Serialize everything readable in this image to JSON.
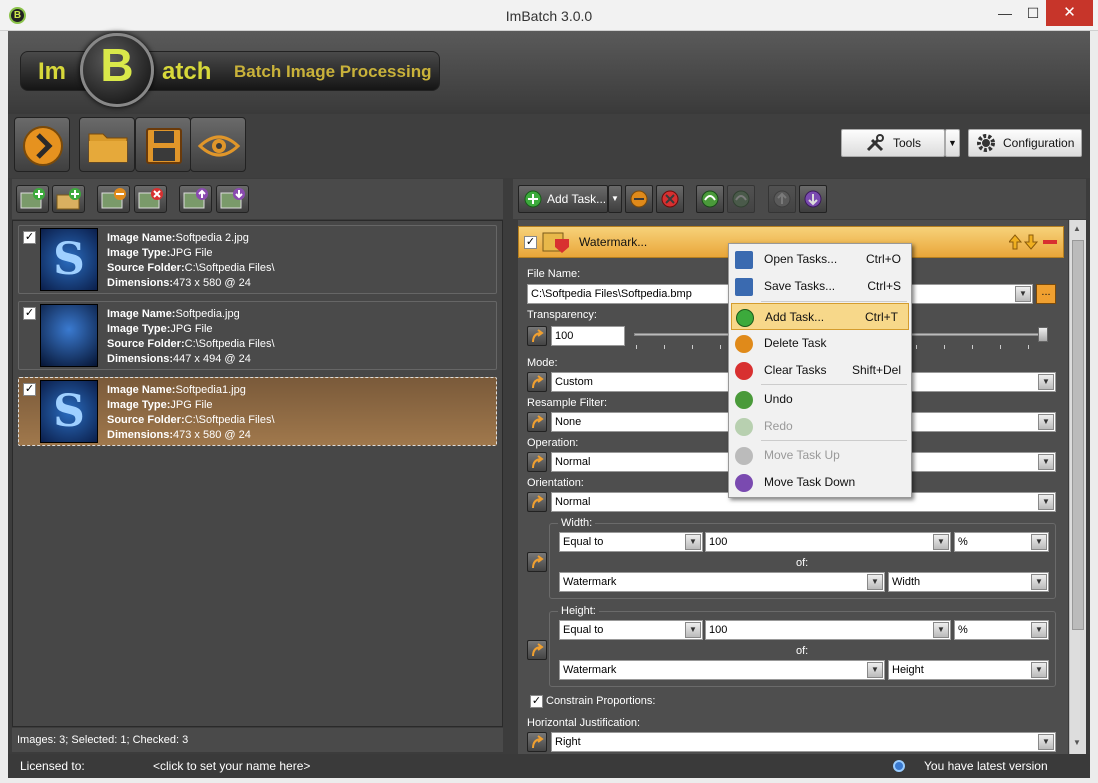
{
  "window": {
    "title": "ImBatch 3.0.0",
    "minimize": "—",
    "maximize": "☐",
    "close": "✕"
  },
  "logo": {
    "im": "Im",
    "b": "B",
    "atch": "atch",
    "subtitle": "Batch Image Processing"
  },
  "toolbar": {
    "tools_label": "Tools",
    "configuration_label": "Configuration"
  },
  "images": [
    {
      "checked": true,
      "name_label": "Image Name:",
      "name": "Softpedia 2.jpg",
      "type_label": "Image Type:",
      "type": "JPG File",
      "folder_label": "Source Folder:",
      "folder": "C:\\Softpedia Files\\",
      "dim_label": "Dimensions:",
      "dimensions": "473 x 580 @ 24"
    },
    {
      "checked": true,
      "name_label": "Image Name:",
      "name": "Softpedia.jpg",
      "type_label": "Image Type:",
      "type": "JPG File",
      "folder_label": "Source Folder:",
      "folder": "C:\\Softpedia Files\\",
      "dim_label": "Dimensions:",
      "dimensions": "447 x 494 @ 24"
    },
    {
      "checked": true,
      "name_label": "Image Name:",
      "name": "Softpedia1.jpg",
      "type_label": "Image Type:",
      "type": "JPG File",
      "folder_label": "Source Folder:",
      "folder": "C:\\Softpedia Files\\",
      "dim_label": "Dimensions:",
      "dimensions": "473 x 580 @ 24"
    }
  ],
  "left_status": "Images: 3; Selected: 1; Checked: 3",
  "tasks_toolbar": {
    "add_task_label": "Add Task..."
  },
  "task": {
    "title": "Watermark...",
    "file_name_label": "File Name:",
    "file_name": "C:\\Softpedia Files\\Softpedia.bmp",
    "browse": "...",
    "transparency_label": "Transparency:",
    "transparency": "100",
    "transparency_level": 1.0,
    "mode_label": "Mode:",
    "mode": "Custom",
    "resample_label": "Resample Filter:",
    "resample": "None",
    "operation_label": "Operation:",
    "operation": "Normal",
    "orientation_label": "Orientation:",
    "orientation": "Normal",
    "width_label": "Width:",
    "width_cond": "Equal to",
    "width_value": "100",
    "width_unit": "%",
    "of_label": "of:",
    "width_of_source": "Watermark",
    "width_of_dim": "Width",
    "height_label": "Height:",
    "height_cond": "Equal to",
    "height_value": "100",
    "height_unit": "%",
    "height_of_source": "Watermark",
    "height_of_dim": "Height",
    "constrain_label": "Constrain Proportions:",
    "constrain_checked": true,
    "hjust_label": "Horizontal Justification:",
    "hjust": "Right"
  },
  "context_menu": [
    {
      "label": "Open Tasks...",
      "shortcut": "Ctrl+O",
      "disabled": false
    },
    {
      "label": "Save Tasks...",
      "shortcut": "Ctrl+S",
      "disabled": false
    },
    {
      "label": "Add Task...",
      "shortcut": "Ctrl+T",
      "disabled": false,
      "highlighted": true
    },
    {
      "label": "Delete Task",
      "shortcut": "",
      "disabled": false
    },
    {
      "label": "Clear Tasks",
      "shortcut": "Shift+Del",
      "disabled": false
    },
    {
      "label": "Undo",
      "shortcut": "",
      "disabled": false
    },
    {
      "label": "Redo",
      "shortcut": "",
      "disabled": true
    },
    {
      "label": "Move Task Up",
      "shortcut": "",
      "disabled": true
    },
    {
      "label": "Move Task Down",
      "shortcut": "",
      "disabled": false
    }
  ],
  "statusbar": {
    "licensed_label": "Licensed to:",
    "licensed_value": "<click to set your name here>",
    "version_status": "You have latest version"
  },
  "colors": {
    "accent_orange": "#e9a639",
    "logo_yellow": "#d7d83a",
    "close_red": "#c7352a"
  }
}
